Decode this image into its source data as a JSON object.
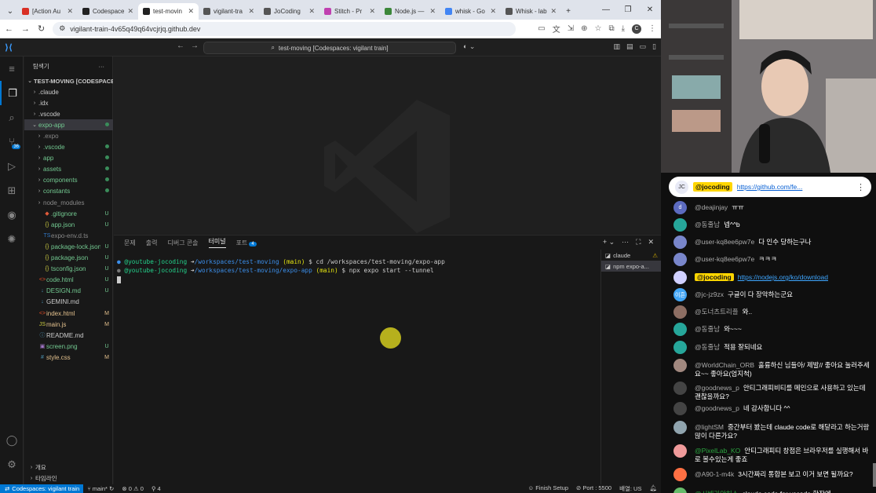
{
  "browser": {
    "tabs": [
      {
        "title": "[Action Au",
        "favicon": "gmail",
        "color": "#d93025"
      },
      {
        "title": "Codespace",
        "favicon": "github",
        "color": "#222"
      },
      {
        "title": "test-movin",
        "favicon": "github",
        "color": "#222",
        "active": true
      },
      {
        "title": "vigilant-tra",
        "favicon": "globe",
        "color": "#555"
      },
      {
        "title": "JoCoding",
        "favicon": "globe",
        "color": "#555"
      },
      {
        "title": "Stitch - Pr",
        "favicon": "stitch",
        "color": "#c040b0"
      },
      {
        "title": "Node.js —",
        "favicon": "node",
        "color": "#3c873a"
      },
      {
        "title": "whisk - Go",
        "favicon": "google",
        "color": "#4285f4"
      },
      {
        "title": "Whisk - lab",
        "favicon": "globe",
        "color": "#555"
      }
    ],
    "new_tab": "+",
    "url": "vigilant-train-4v65q49q64vcjrjq.github.dev",
    "profile": "C"
  },
  "vscode": {
    "command_center": "test-moving [Codespaces: vigilant train]",
    "explorer_title": "탐색기",
    "workspace": "TEST-MOVING [CODESPACE...",
    "tree": [
      {
        "name": ".claude",
        "depth": 0,
        "chev": "›",
        "icon": "",
        "status": ""
      },
      {
        "name": ".idx",
        "depth": 0,
        "chev": "›",
        "icon": "",
        "status": ""
      },
      {
        "name": ".vscode",
        "depth": 0,
        "chev": "›",
        "icon": "",
        "status": ""
      },
      {
        "name": "expo-app",
        "depth": 0,
        "chev": "⌄",
        "icon": "",
        "status": "dot",
        "color": "#73c991",
        "selected": true
      },
      {
        "name": ".expo",
        "depth": 1,
        "chev": "›",
        "icon": "",
        "status": "",
        "color": "#888"
      },
      {
        "name": ".vscode",
        "depth": 1,
        "chev": "›",
        "icon": "",
        "status": "dot",
        "color": "#73c991"
      },
      {
        "name": "app",
        "depth": 1,
        "chev": "›",
        "icon": "",
        "status": "dot",
        "color": "#73c991"
      },
      {
        "name": "assets",
        "depth": 1,
        "chev": "›",
        "icon": "",
        "status": "dot",
        "color": "#73c991"
      },
      {
        "name": "components",
        "depth": 1,
        "chev": "›",
        "icon": "",
        "status": "dot",
        "color": "#73c991"
      },
      {
        "name": "constants",
        "depth": 1,
        "chev": "›",
        "icon": "",
        "status": "dot",
        "color": "#73c991"
      },
      {
        "name": "node_modules",
        "depth": 1,
        "chev": "›",
        "icon": "",
        "status": "",
        "color": "#888"
      },
      {
        "name": ".gitignore",
        "depth": 1,
        "chev": "",
        "icon": "◆",
        "icolor": "#e05a3a",
        "status": "U",
        "color": "#73c991"
      },
      {
        "name": "app.json",
        "depth": 1,
        "chev": "",
        "icon": "{}",
        "icolor": "#cbcb41",
        "status": "U",
        "color": "#73c991"
      },
      {
        "name": "expo-env.d.ts",
        "depth": 1,
        "chev": "",
        "icon": "TS",
        "icolor": "#3178c6",
        "status": "",
        "color": "#888"
      },
      {
        "name": "package-lock.json",
        "depth": 1,
        "chev": "",
        "icon": "{}",
        "icolor": "#cbcb41",
        "status": "U",
        "color": "#73c991"
      },
      {
        "name": "package.json",
        "depth": 1,
        "chev": "",
        "icon": "{}",
        "icolor": "#cbcb41",
        "status": "U",
        "color": "#73c991"
      },
      {
        "name": "tsconfig.json",
        "depth": 1,
        "chev": "",
        "icon": "{}",
        "icolor": "#cbcb41",
        "status": "U",
        "color": "#73c991"
      },
      {
        "name": "code.html",
        "depth": 0,
        "chev": "",
        "icon": "<>",
        "icolor": "#e44d26",
        "status": "U",
        "color": "#73c991"
      },
      {
        "name": "DESIGN.md",
        "depth": 0,
        "chev": "",
        "icon": "↓",
        "icolor": "#519aba",
        "status": "U",
        "color": "#73c991"
      },
      {
        "name": "GEMINI.md",
        "depth": 0,
        "chev": "",
        "icon": "↓",
        "icolor": "#519aba",
        "status": "",
        "color": "#ccc"
      },
      {
        "name": "index.html",
        "depth": 0,
        "chev": "",
        "icon": "<>",
        "icolor": "#e44d26",
        "status": "M",
        "color": "#e2c08d"
      },
      {
        "name": "main.js",
        "depth": 0,
        "chev": "",
        "icon": "JS",
        "icolor": "#cbcb41",
        "status": "M",
        "color": "#e2c08d"
      },
      {
        "name": "README.md",
        "depth": 0,
        "chev": "",
        "icon": "ⓘ",
        "icolor": "#519aba",
        "status": "",
        "color": "#ccc"
      },
      {
        "name": "screen.png",
        "depth": 0,
        "chev": "",
        "icon": "▣",
        "icolor": "#a074c4",
        "status": "U",
        "color": "#73c991"
      },
      {
        "name": "style.css",
        "depth": 0,
        "chev": "",
        "icon": "#",
        "icolor": "#519aba",
        "status": "M",
        "color": "#e2c08d"
      }
    ],
    "outline_label": "개요",
    "timeline_label": "타임라인",
    "panel_tabs": [
      "문제",
      "출력",
      "디버그 콘솔",
      "터미널",
      "포트"
    ],
    "ports_count": "4",
    "terminal": [
      {
        "user": "@youtube-jocoding",
        "path": "/workspaces/test-moving",
        "branch": "(main)",
        "cmd": "$ cd /workspaces/test-moving/expo-app"
      },
      {
        "user": "@youtube-jocoding",
        "path": "/workspaces/test-moving/expo-app",
        "branch": "(main)",
        "cmd": "$ npx expo start --tunnel"
      }
    ],
    "terminal_list": [
      "claude",
      "npm expo-a..."
    ],
    "status": {
      "remote": "Codespaces: vigilant train",
      "branch": "main*",
      "errors": "0",
      "warnings": "0",
      "ports": "4",
      "finish": "Finish Setup",
      "port": "Port : 5500",
      "layout": "배열: US"
    }
  },
  "chat": {
    "pinned": {
      "user": "@jocoding",
      "link": "https://github.com/fe..."
    },
    "messages": [
      {
        "author": "@deajinjay",
        "text": "ㅠㅠ",
        "avatar": "d",
        "color": "#5c6bc0"
      },
      {
        "author": "@동줄남",
        "text": "넵^^b",
        "avatar": "",
        "color": "#26a69a"
      },
      {
        "author": "@user-kq8ee6pw7e",
        "text": "다 인수 당하는구나",
        "avatar": "",
        "color": "#7986cb"
      },
      {
        "author": "@user-kq8ee6pw7e",
        "text": "ㅋㅋㅋ",
        "avatar": "",
        "color": "#7986cb"
      },
      {
        "author": "@jocoding",
        "text": "https://nodejs.org/ko/download",
        "avatar": "",
        "color": "#d0d0ff",
        "owner": true,
        "link": true
      },
      {
        "author": "@jc-jz9zx",
        "text": "구글이 다 장악하는군요",
        "avatar": "이흔",
        "color": "#42a5f5"
      },
      {
        "author": "@도너츠트리플",
        "text": "와..",
        "avatar": "",
        "color": "#8d6e63"
      },
      {
        "author": "@동줄남",
        "text": "와~~~",
        "avatar": "",
        "color": "#26a69a"
      },
      {
        "author": "@동줄남",
        "text": "적용 잘되네요",
        "avatar": "",
        "color": "#26a69a"
      },
      {
        "author": "@WorldChain_ORB",
        "text": "훌륭하신 님들아/ 제발// 좋아요 눌러주세요~~ 좋아요(엄지척)",
        "avatar": "",
        "color": "#a1887f"
      },
      {
        "author": "@goodnews_p",
        "text": "안티그래피비티를 메인으로 사용하고 있는데 괜찮을까요?",
        "avatar": "",
        "color": "#444"
      },
      {
        "author": "@goodnews_p",
        "text": "네 감사합니다 ^^",
        "avatar": "",
        "color": "#444"
      },
      {
        "author": "@lightSM",
        "text": "중간부터 봤는데 claude code로 해달라고 하는거랑 많이 다른가요?",
        "avatar": "",
        "color": "#90a4ae"
      },
      {
        "author": "@PixelLab_KO",
        "text": "안티그래피티 창점은 브라우저를 실행해서 바로 볼수있는게 좋죠",
        "avatar": "",
        "color": "#ef9a9a",
        "member": true
      },
      {
        "author": "@A90-1-m4k",
        "text": "3시간짜리 통합본 보고 이거 보면 될까요?",
        "avatar": "",
        "color": "#ff7043"
      },
      {
        "author": "@시베리안허스",
        "text": "claude code for vscode 확장엔",
        "avatar": "",
        "color": "#66bb6a",
        "member": true
      }
    ]
  }
}
